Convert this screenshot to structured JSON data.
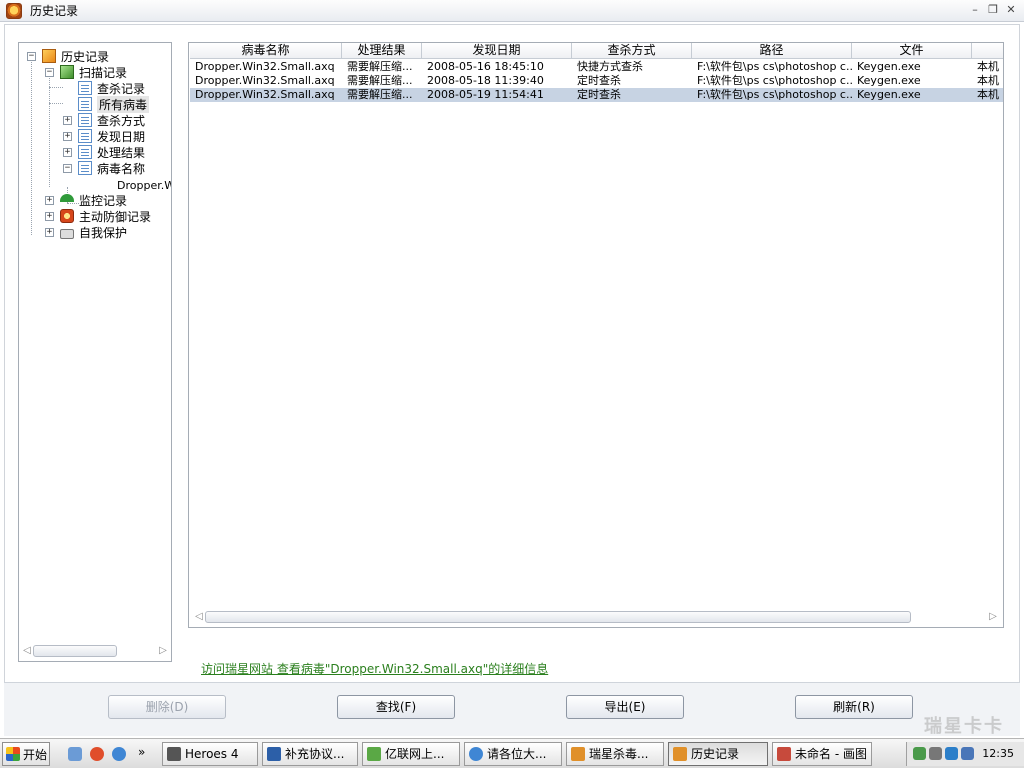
{
  "window": {
    "title": "历史记录"
  },
  "tree": {
    "root": "历史记录",
    "scan": "扫描记录",
    "scan_children": [
      "查杀记录",
      "所有病毒",
      "查杀方式",
      "发现日期",
      "处理结果",
      "病毒名称"
    ],
    "virus_child": "Dropper.W",
    "others": [
      "监控记录",
      "主动防御记录",
      "自我保护"
    ]
  },
  "grid": {
    "columns": [
      "病毒名称",
      "处理结果",
      "发现日期",
      "查杀方式",
      "路径",
      "文件",
      ""
    ],
    "rows": [
      [
        "Dropper.Win32.Small.axq",
        "需要解压缩...",
        "2008-05-16 18:45:10",
        "快捷方式查杀",
        "F:\\软件包\\ps cs\\photoshop c...",
        "Keygen.exe",
        "本机"
      ],
      [
        "Dropper.Win32.Small.axq",
        "需要解压缩...",
        "2008-05-18 11:39:40",
        "定时查杀",
        "F:\\软件包\\ps cs\\photoshop c...",
        "Keygen.exe",
        "本机"
      ],
      [
        "Dropper.Win32.Small.axq",
        "需要解压缩...",
        "2008-05-19 11:54:41",
        "定时查杀",
        "F:\\软件包\\ps cs\\photoshop c...",
        "Keygen.exe",
        "本机"
      ]
    ]
  },
  "info_link": "访问瑞星网站 查看病毒\"Dropper.Win32.Small.axq\"的详细信息",
  "buttons": {
    "delete": "删除(D)",
    "find": "查找(F)",
    "export": "导出(E)",
    "refresh": "刷新(R)"
  },
  "taskbar": {
    "start": "开始",
    "tasks": [
      "Heroes 4",
      "补充协议...",
      "亿联网上...",
      "请各位大...",
      "瑞星杀毒...",
      "历史记录",
      "未命名 - 画图"
    ],
    "clock": "12:35"
  },
  "watermark": "瑞星卡卡"
}
